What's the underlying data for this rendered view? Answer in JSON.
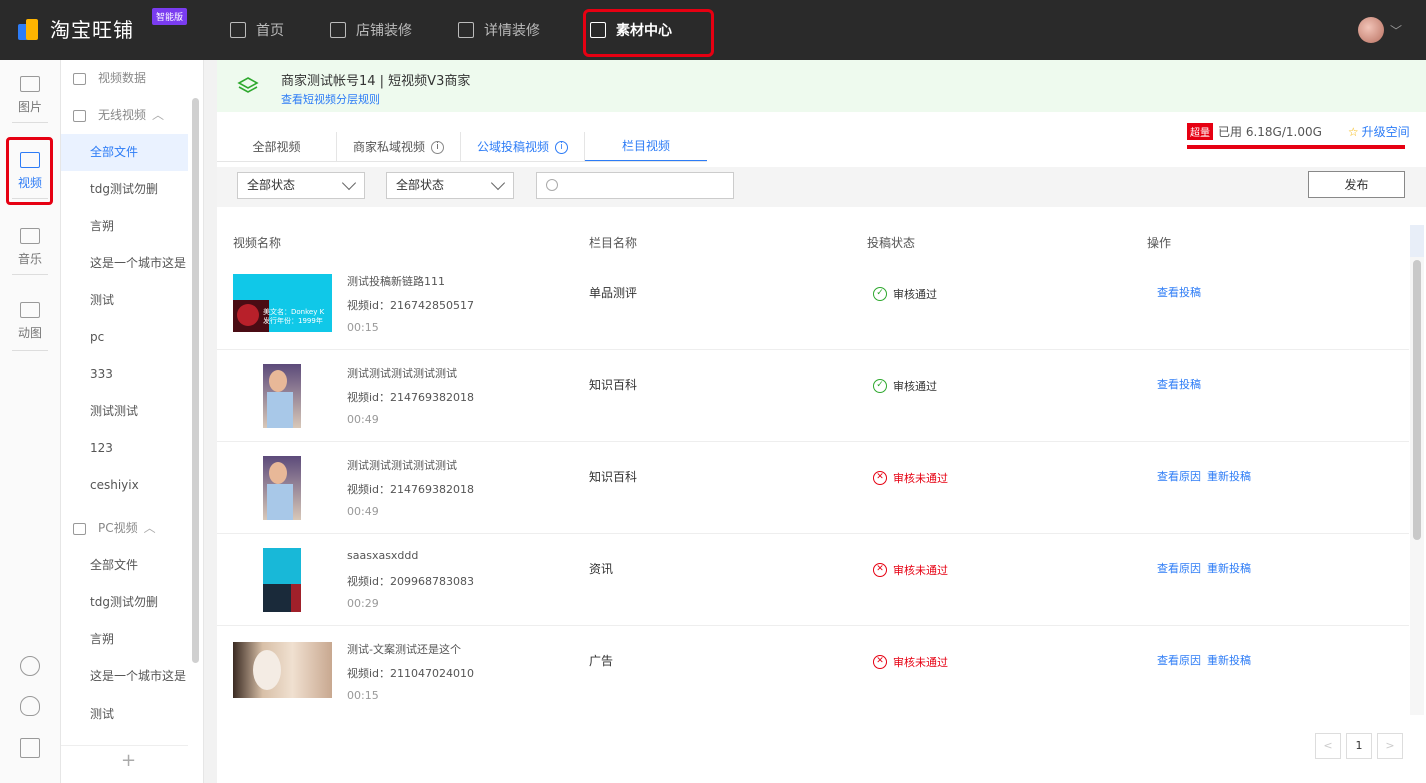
{
  "topbar": {
    "logo_text": "淘宝旺铺",
    "logo_badge": "智能版",
    "nav": [
      {
        "label": "首页",
        "icon": "home-icon"
      },
      {
        "label": "店铺装修",
        "icon": "shop-icon"
      },
      {
        "label": "详情装修",
        "icon": "detail-icon"
      },
      {
        "label": "素材中心",
        "icon": "folder-icon",
        "active": true
      }
    ]
  },
  "rail": {
    "items": [
      {
        "label": "图片",
        "icon": "image-icon"
      },
      {
        "label": "视频",
        "icon": "video-icon",
        "active": true
      },
      {
        "label": "音乐",
        "icon": "music-icon"
      },
      {
        "label": "动图",
        "icon": "gif-icon"
      }
    ],
    "bottom_icons": [
      "help-icon",
      "support-icon",
      "edit-icon"
    ]
  },
  "tree": {
    "top_item": "视频数据",
    "group1": "无线视频",
    "group1_items": [
      "全部文件",
      "tdg测试勿删",
      "言朔",
      "这是一个城市这是",
      "测试",
      "pc",
      "333",
      "测试测试",
      "123",
      "ceshiyix"
    ],
    "group2": "PC视频",
    "group2_items": [
      "全部文件",
      "tdg测试勿删",
      "言朔",
      "这是一个城市这是",
      "测试"
    ],
    "add": "+"
  },
  "banner": {
    "title": "商家测试帐号14 | 短视频V3商家",
    "link": "查看短视频分层规则"
  },
  "tabs": [
    {
      "label": "全部视频"
    },
    {
      "label": "商家私域视频",
      "info": "i"
    },
    {
      "label": "公域投稿视频",
      "info": "i"
    },
    {
      "label": "栏目视频",
      "active": true
    }
  ],
  "storage": {
    "badge": "超量",
    "used": "已用 6.18G/1.00G",
    "upgrade": "升级空间",
    "upgrade_icon": "star-icon",
    "used_fraction": 1.0
  },
  "filters": {
    "status1": "全部状态",
    "status2": "全部状态",
    "search_placeholder": "",
    "publish": "发布"
  },
  "table": {
    "headers": [
      "视频名称",
      "栏目名称",
      "投稿状态",
      "操作"
    ],
    "rows": [
      {
        "title": "测试投稿新链路111",
        "id": "视频id：216742850517",
        "duration": "00:15",
        "category": "单品测评",
        "status": "审核通过",
        "status_type": "approved",
        "ops": [
          "查看投稿"
        ]
      },
      {
        "title": "测试测试测试测试测试",
        "id": "视频id：214769382018",
        "duration": "00:49",
        "category": "知识百科",
        "status": "审核通过",
        "status_type": "approved",
        "ops": [
          "查看投稿"
        ]
      },
      {
        "title": "测试测试测试测试测试",
        "id": "视频id：214769382018",
        "duration": "00:49",
        "category": "知识百科",
        "status": "审核未通过",
        "status_type": "rejected",
        "ops": [
          "查看原因",
          "重新投稿"
        ]
      },
      {
        "title": "saasxasxddd",
        "id": "视频id：209968783083",
        "duration": "00:29",
        "category": "资讯",
        "status": "审核未通过",
        "status_type": "rejected",
        "ops": [
          "查看原因",
          "重新投稿"
        ]
      },
      {
        "title": "测试-文案测试还是这个",
        "id": "视频id：211047024010",
        "duration": "00:15",
        "category": "广告",
        "status": "审核未通过",
        "status_type": "rejected",
        "ops": [
          "查看原因",
          "重新投稿"
        ]
      }
    ],
    "thumb1_caption": "美文名：Donkey K 发行年份：1999年"
  },
  "pagination": {
    "prev": "<",
    "current": "1",
    "next": ">"
  },
  "colors": {
    "accent": "#2d7cf6",
    "danger": "#e60012",
    "success": "#2ea82e",
    "topbar": "#2a2a2a"
  }
}
